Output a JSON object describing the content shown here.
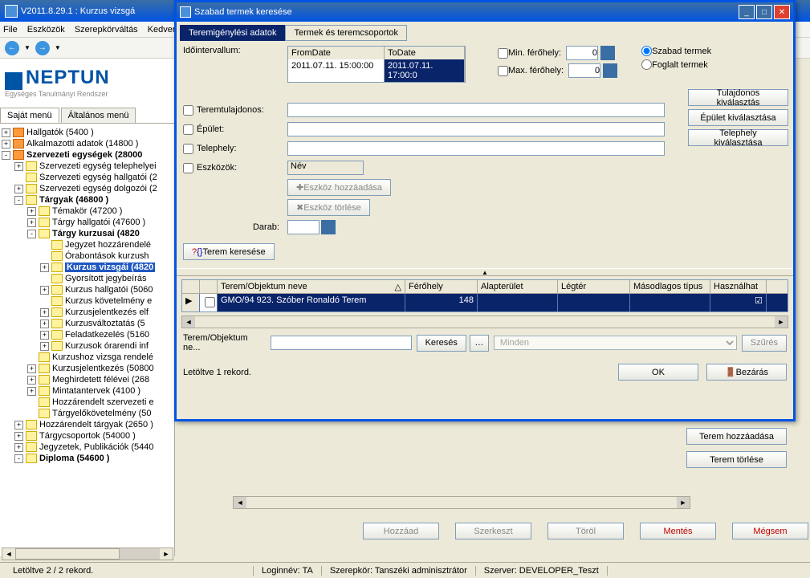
{
  "main": {
    "title": "V2011.8.29.1 : Kurzus vizsgá",
    "menu": [
      "File",
      "Eszközök",
      "Szerepkörváltás",
      "Kedven"
    ],
    "logo": "NEPTUN",
    "logo_sub": "Egységes Tanulmányi Rendszer",
    "tabs": [
      "Saját menü",
      "Általános menü"
    ],
    "status_left": "Letöltve 2 / 2 rekord.",
    "status_login": "Loginnév: TA",
    "status_role": "Szerepkör: Tanszéki adminisztrátor",
    "status_server": "Szerver: DEVELOPER_Teszt"
  },
  "tree": [
    {
      "indent": 0,
      "exp": "+",
      "icon": "orange",
      "label": "Hallgatók (5400 )"
    },
    {
      "indent": 0,
      "exp": "+",
      "icon": "orange",
      "label": "Alkalmazotti adatok (14800 )"
    },
    {
      "indent": 0,
      "exp": "-",
      "icon": "orange",
      "label": "Szervezeti egységek (28000",
      "bold": true
    },
    {
      "indent": 1,
      "exp": "+",
      "icon": "yellow",
      "label": "Szervezeti egység telephelyei"
    },
    {
      "indent": 1,
      "exp": "",
      "icon": "yellow",
      "label": "Szervezeti egység hallgatói (2"
    },
    {
      "indent": 1,
      "exp": "+",
      "icon": "yellow",
      "label": "Szervezeti egység dolgozói (2"
    },
    {
      "indent": 1,
      "exp": "-",
      "icon": "yellow",
      "label": "Tárgyak (46800  )",
      "bold": true
    },
    {
      "indent": 2,
      "exp": "+",
      "icon": "yellow",
      "label": "Témakör (47200  )"
    },
    {
      "indent": 2,
      "exp": "+",
      "icon": "yellow",
      "label": "Tárgy hallgatói (47600  )"
    },
    {
      "indent": 2,
      "exp": "-",
      "icon": "yellow",
      "label": "Tárgy kurzusai (4820",
      "bold": true
    },
    {
      "indent": 3,
      "exp": "",
      "icon": "yellow",
      "label": "Jegyzet hozzárendelé"
    },
    {
      "indent": 3,
      "exp": "",
      "icon": "yellow",
      "label": "Órabontások kurzush"
    },
    {
      "indent": 3,
      "exp": "+",
      "icon": "yellow",
      "label": "Kurzus vizsgái (4820",
      "selected": true
    },
    {
      "indent": 3,
      "exp": "",
      "icon": "yellow",
      "label": "Gyorsított jegybeírás"
    },
    {
      "indent": 3,
      "exp": "+",
      "icon": "yellow",
      "label": "Kurzus hallgatói (5060"
    },
    {
      "indent": 3,
      "exp": "",
      "icon": "yellow",
      "label": "Kurzus követelmény e"
    },
    {
      "indent": 3,
      "exp": "+",
      "icon": "yellow",
      "label": "Kurzusjelentkezés elf"
    },
    {
      "indent": 3,
      "exp": "+",
      "icon": "yellow",
      "label": "Kurzusváltoztatás (5"
    },
    {
      "indent": 3,
      "exp": "+",
      "icon": "yellow",
      "label": "Feladatkezelés (5160"
    },
    {
      "indent": 3,
      "exp": "+",
      "icon": "yellow",
      "label": "Kurzusok órarendi inf"
    },
    {
      "indent": 2,
      "exp": "",
      "icon": "yellow",
      "label": "Kurzushoz vizsga rendelé"
    },
    {
      "indent": 2,
      "exp": "+",
      "icon": "yellow",
      "label": "Kurzusjelentkezés (50800"
    },
    {
      "indent": 2,
      "exp": "+",
      "icon": "yellow",
      "label": "Meghirdetett félévei (268"
    },
    {
      "indent": 2,
      "exp": "+",
      "icon": "yellow",
      "label": "Mintatantervek (4100  )"
    },
    {
      "indent": 2,
      "exp": "",
      "icon": "yellow",
      "label": "Hozzárendelt szervezeti e"
    },
    {
      "indent": 2,
      "exp": "",
      "icon": "yellow",
      "label": "Tárgyelőkövetelmény (50"
    },
    {
      "indent": 1,
      "exp": "+",
      "icon": "yellow",
      "label": "Hozzárendelt tárgyak (2650  )"
    },
    {
      "indent": 1,
      "exp": "+",
      "icon": "yellow",
      "label": "Tárgycsoportok (54000  )"
    },
    {
      "indent": 1,
      "exp": "+",
      "icon": "yellow",
      "label": "Jegyzetek, Publikációk (5440"
    },
    {
      "indent": 1,
      "exp": "-",
      "icon": "yellow",
      "label": "Diploma (54600  )",
      "bold": true
    }
  ],
  "dialog": {
    "title": "Szabad termek keresése",
    "tab_active": "Teremigénylési adatok",
    "tab_other": "Termek és teremcsoportok",
    "interval_label": "Időintervallum:",
    "from_hdr": "FromDate",
    "to_hdr": "ToDate",
    "from_val": "2011.07.11. 15:00:00",
    "to_val": "2011.07.11. 17:00:0",
    "min_cap": "Min. férőhely:",
    "max_cap": "Max. férőhely:",
    "min_val": "0",
    "max_val": "0",
    "radio_free": "Szabad termek",
    "radio_busy": "Foglalt termek",
    "owner": "Teremtulajdonos:",
    "building": "Épület:",
    "site": "Telephely:",
    "tools": "Eszközök:",
    "tools_val": "Név",
    "add_tool": "Eszköz hozzáadása",
    "del_tool": "Eszköz törlése",
    "count": "Darab:",
    "search_room": "Terem keresése",
    "owner_btn": "Tulajdonos kiválasztás",
    "building_btn": "Épület kiválasztása",
    "site_btn": "Telephely kiválasztása",
    "grid_headers": [
      "Terem/Objektum neve",
      "Férőhely",
      "Alapterület",
      "Légtér",
      "Másodlagos típus",
      "Használhat"
    ],
    "grid_row_name": "GMO/94 923. Szóber Ronaldó Terem",
    "grid_row_cap": "148",
    "filter_label": "Terem/Objektum ne...",
    "filter_btn": "Keresés",
    "filter_all": "Minden",
    "filter_apply": "Szűrés",
    "footer_status": "Letöltve 1 rekord.",
    "ok": "OK",
    "close": "Bezárás"
  },
  "parent": {
    "add_room": "Terem hozzáadása",
    "del_room": "Terem törlése",
    "b_add": "Hozzáad",
    "b_edit": "Szerkeszt",
    "b_del": "Töröl",
    "b_save": "Mentés",
    "b_cancel": "Mégsem"
  }
}
